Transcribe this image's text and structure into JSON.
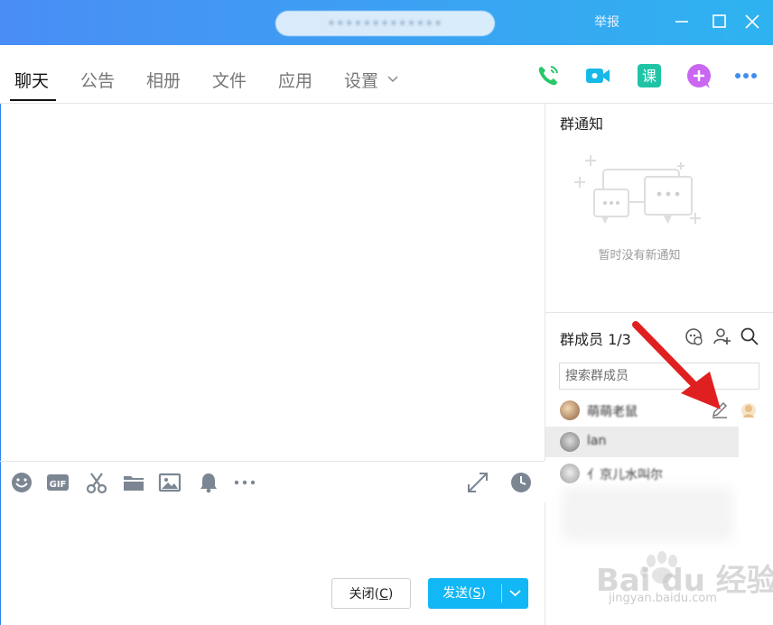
{
  "window": {
    "title": "•••••••••••••",
    "report_label": "举报"
  },
  "tabs": [
    {
      "label": "聊天",
      "active": true
    },
    {
      "label": "公告"
    },
    {
      "label": "相册"
    },
    {
      "label": "文件"
    },
    {
      "label": "应用"
    },
    {
      "label": "设置"
    }
  ],
  "toolbar_icons": [
    "phone-icon",
    "video-icon",
    "class-icon",
    "add-app-icon",
    "more-icon"
  ],
  "composer_icons": [
    "emoji-icon",
    "gif-icon",
    "scissors-icon",
    "folder-icon",
    "image-icon",
    "bell-icon",
    "more-icon",
    "expand-icon",
    "history-icon"
  ],
  "buttons": {
    "close": "关闭(C)",
    "close_text": "关闭(",
    "close_key": "C",
    "close_end": ")",
    "send_text": "发送(",
    "send_key": "S",
    "send_end": ")"
  },
  "notice": {
    "title": "群通知",
    "empty_text": "暂时没有新通知"
  },
  "members": {
    "title": "群成员 1/3",
    "search_placeholder": "搜索群成员",
    "list": [
      {
        "name": "萌萌老鼠",
        "selected": false
      },
      {
        "name": "lan",
        "selected": true
      },
      {
        "name": "亻京儿水叫尔",
        "selected": false
      }
    ]
  },
  "watermark": {
    "brand": "Bai du 经验",
    "sub": "jingyan.baidu.com"
  },
  "colors": {
    "title_gradient_start": "#4a8df5",
    "title_gradient_end": "#2eb3f0",
    "send_button": "#12b7f5",
    "phone_icon": "#27c86a",
    "video_icon": "#18b9e9",
    "class_icon": "#1fc4a7",
    "add_icon": "#c966f2",
    "more_icon": "#3f8cf0",
    "arrow": "#e02020"
  }
}
